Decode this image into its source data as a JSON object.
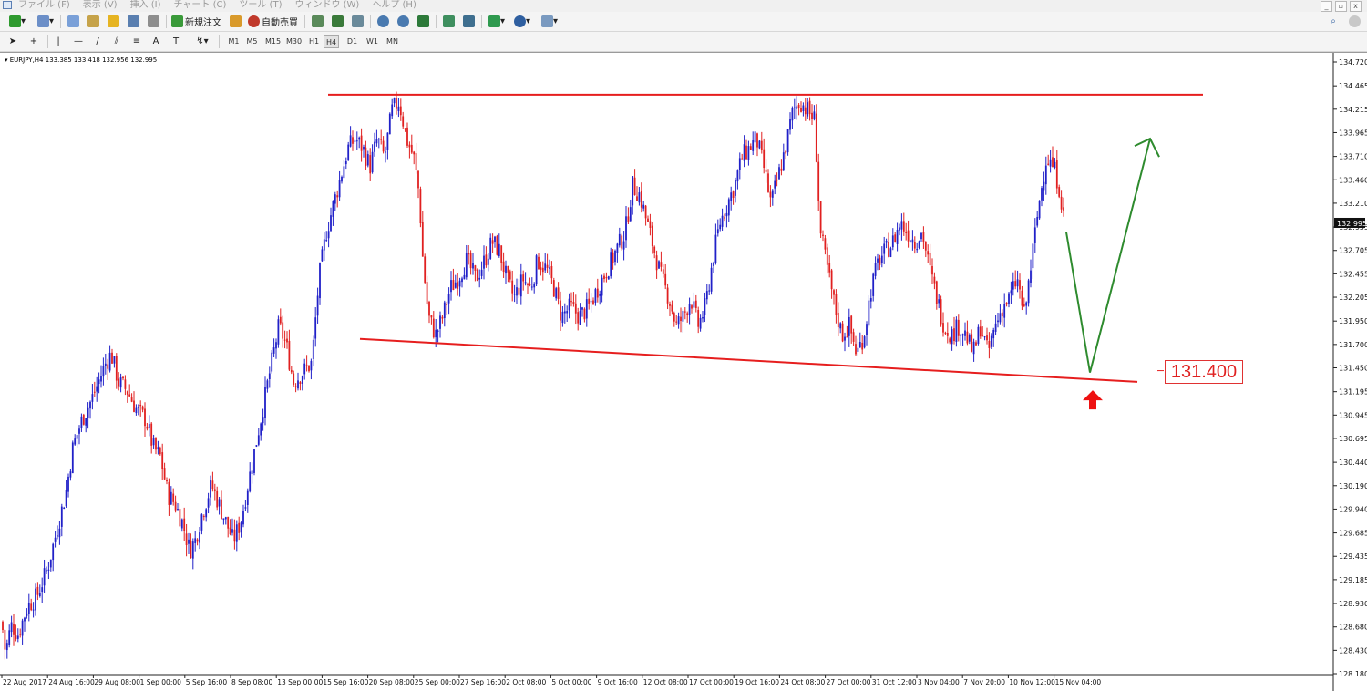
{
  "menu": [
    "ファイル (F)",
    "表示 (V)",
    "挿入 (I)",
    "チャート (C)",
    "ツール (T)",
    "ウィンドウ (W)",
    "ヘルプ (H)"
  ],
  "toolbar": {
    "new_order_label": "新規注文",
    "auto_trade_label": "自動売買",
    "timeframes": [
      "M1",
      "M5",
      "M15",
      "M30",
      "H1",
      "H4",
      "D1",
      "W1",
      "MN"
    ],
    "active_timeframe": "H4"
  },
  "chart_info": "EURJPY,H4  133.385 133.418 132.956 132.995",
  "colors": {
    "bull": "#2020c8",
    "bear": "#e02020",
    "support": "#e61e1e",
    "arrow": "#2e8b2e"
  },
  "chart_data": {
    "type": "candlestick",
    "symbol": "EURJPY",
    "timeframe": "H4",
    "ylim": [
      128.18,
      134.72
    ],
    "y_ticks": [
      "134.720",
      "134.465",
      "134.215",
      "133.965",
      "133.710",
      "133.460",
      "133.210",
      "132.955",
      "132.705",
      "132.455",
      "132.205",
      "131.950",
      "131.700",
      "131.450",
      "131.195",
      "130.945",
      "130.695",
      "130.440",
      "130.190",
      "129.940",
      "129.685",
      "129.435",
      "129.185",
      "128.930",
      "128.680",
      "128.430",
      "128.180"
    ],
    "current_price": "132.995",
    "x_ticks": [
      "22 Aug 2017",
      "24 Aug 16:00",
      "29 Aug 08:00",
      "1 Sep 00:00",
      "5 Sep 16:00",
      "8 Sep 08:00",
      "13 Sep 00:00",
      "15 Sep 16:00",
      "20 Sep 08:00",
      "25 Sep 00:00",
      "27 Sep 16:00",
      "2 Oct 08:00",
      "5 Oct 00:00",
      "9 Oct 16:00",
      "12 Oct 08:00",
      "17 Oct 00:00",
      "19 Oct 16:00",
      "24 Oct 08:00",
      "27 Oct 00:00",
      "31 Oct 12:00",
      "3 Nov 04:00",
      "7 Nov 20:00",
      "10 Nov 12:00",
      "15 Nov 04:00"
    ],
    "close_path": [
      [
        0,
        128.9
      ],
      [
        6,
        128.4
      ],
      [
        12,
        128.7
      ],
      [
        20,
        128.6
      ],
      [
        30,
        128.9
      ],
      [
        40,
        129.0
      ],
      [
        52,
        129.3
      ],
      [
        62,
        129.7
      ],
      [
        72,
        130.1
      ],
      [
        80,
        130.6
      ],
      [
        90,
        130.9
      ],
      [
        100,
        131.1
      ],
      [
        108,
        131.3
      ],
      [
        116,
        131.5
      ],
      [
        122,
        131.6
      ],
      [
        130,
        131.3
      ],
      [
        140,
        131.2
      ],
      [
        150,
        131.0
      ],
      [
        160,
        130.9
      ],
      [
        168,
        130.6
      ],
      [
        176,
        130.5
      ],
      [
        184,
        130.1
      ],
      [
        192,
        130.0
      ],
      [
        200,
        129.8
      ],
      [
        208,
        129.5
      ],
      [
        214,
        129.6
      ],
      [
        222,
        129.9
      ],
      [
        232,
        130.2
      ],
      [
        240,
        130.0
      ],
      [
        248,
        129.8
      ],
      [
        256,
        129.6
      ],
      [
        264,
        129.8
      ],
      [
        272,
        130.2
      ],
      [
        280,
        130.6
      ],
      [
        290,
        131.1
      ],
      [
        298,
        131.5
      ],
      [
        306,
        131.9
      ],
      [
        314,
        131.7
      ],
      [
        322,
        131.3
      ],
      [
        332,
        131.4
      ],
      [
        342,
        131.5
      ],
      [
        350,
        132.4
      ],
      [
        358,
        132.9
      ],
      [
        366,
        133.2
      ],
      [
        374,
        133.5
      ],
      [
        382,
        133.8
      ],
      [
        390,
        133.9
      ],
      [
        398,
        133.8
      ],
      [
        406,
        133.6
      ],
      [
        414,
        133.9
      ],
      [
        422,
        133.7
      ],
      [
        430,
        134.2
      ],
      [
        438,
        134.3
      ],
      [
        446,
        133.9
      ],
      [
        454,
        133.7
      ],
      [
        460,
        133.3
      ],
      [
        464,
        132.6
      ],
      [
        470,
        132.0
      ],
      [
        478,
        131.8
      ],
      [
        486,
        132.0
      ],
      [
        494,
        132.3
      ],
      [
        502,
        132.4
      ],
      [
        512,
        132.6
      ],
      [
        522,
        132.4
      ],
      [
        532,
        132.6
      ],
      [
        540,
        132.8
      ],
      [
        548,
        132.7
      ],
      [
        556,
        132.4
      ],
      [
        564,
        132.2
      ],
      [
        574,
        132.4
      ],
      [
        582,
        132.3
      ],
      [
        590,
        132.6
      ],
      [
        600,
        132.5
      ],
      [
        608,
        132.3
      ],
      [
        616,
        132.0
      ],
      [
        626,
        132.1
      ],
      [
        636,
        132.0
      ],
      [
        646,
        132.1
      ],
      [
        656,
        132.3
      ],
      [
        666,
        132.5
      ],
      [
        676,
        132.7
      ],
      [
        686,
        132.9
      ],
      [
        694,
        133.4
      ],
      [
        702,
        133.3
      ],
      [
        710,
        133.0
      ],
      [
        718,
        132.7
      ],
      [
        726,
        132.4
      ],
      [
        734,
        132.2
      ],
      [
        742,
        131.9
      ],
      [
        750,
        132.0
      ],
      [
        758,
        132.2
      ],
      [
        766,
        131.9
      ],
      [
        774,
        132.1
      ],
      [
        782,
        132.6
      ],
      [
        790,
        133.0
      ],
      [
        798,
        133.2
      ],
      [
        806,
        133.4
      ],
      [
        814,
        133.7
      ],
      [
        822,
        133.8
      ],
      [
        830,
        133.9
      ],
      [
        838,
        133.6
      ],
      [
        846,
        133.2
      ],
      [
        854,
        133.5
      ],
      [
        862,
        133.8
      ],
      [
        870,
        134.2
      ],
      [
        878,
        134.3
      ],
      [
        886,
        134.2
      ],
      [
        894,
        134.1
      ],
      [
        900,
        132.9
      ],
      [
        908,
        132.5
      ],
      [
        916,
        132.1
      ],
      [
        924,
        131.8
      ],
      [
        932,
        131.9
      ],
      [
        940,
        131.6
      ],
      [
        948,
        131.8
      ],
      [
        956,
        132.3
      ],
      [
        964,
        132.6
      ],
      [
        972,
        132.7
      ],
      [
        980,
        132.8
      ],
      [
        988,
        133.0
      ],
      [
        996,
        132.9
      ],
      [
        1004,
        132.8
      ],
      [
        1012,
        132.9
      ],
      [
        1020,
        132.5
      ],
      [
        1028,
        132.2
      ],
      [
        1036,
        131.9
      ],
      [
        1044,
        131.8
      ],
      [
        1052,
        131.9
      ],
      [
        1060,
        131.8
      ],
      [
        1068,
        131.6
      ],
      [
        1076,
        131.9
      ],
      [
        1084,
        131.6
      ],
      [
        1092,
        131.9
      ],
      [
        1100,
        132.1
      ],
      [
        1108,
        132.2
      ],
      [
        1116,
        132.4
      ],
      [
        1124,
        132.0
      ],
      [
        1132,
        132.6
      ],
      [
        1140,
        133.2
      ],
      [
        1148,
        133.7
      ],
      [
        1156,
        133.6
      ],
      [
        1162,
        133.4
      ],
      [
        1168,
        133.0
      ]
    ],
    "annotations": {
      "resistance_line": [
        [
          360,
          134.37
        ],
        [
          1320,
          134.37
        ]
      ],
      "support_line": [
        [
          395,
          131.76
        ],
        [
          1248,
          131.3
        ]
      ],
      "projection_path": [
        [
          1170,
          132.9
        ],
        [
          1196,
          131.4
        ],
        [
          1262,
          133.9
        ]
      ],
      "target_label": "131.400"
    }
  }
}
